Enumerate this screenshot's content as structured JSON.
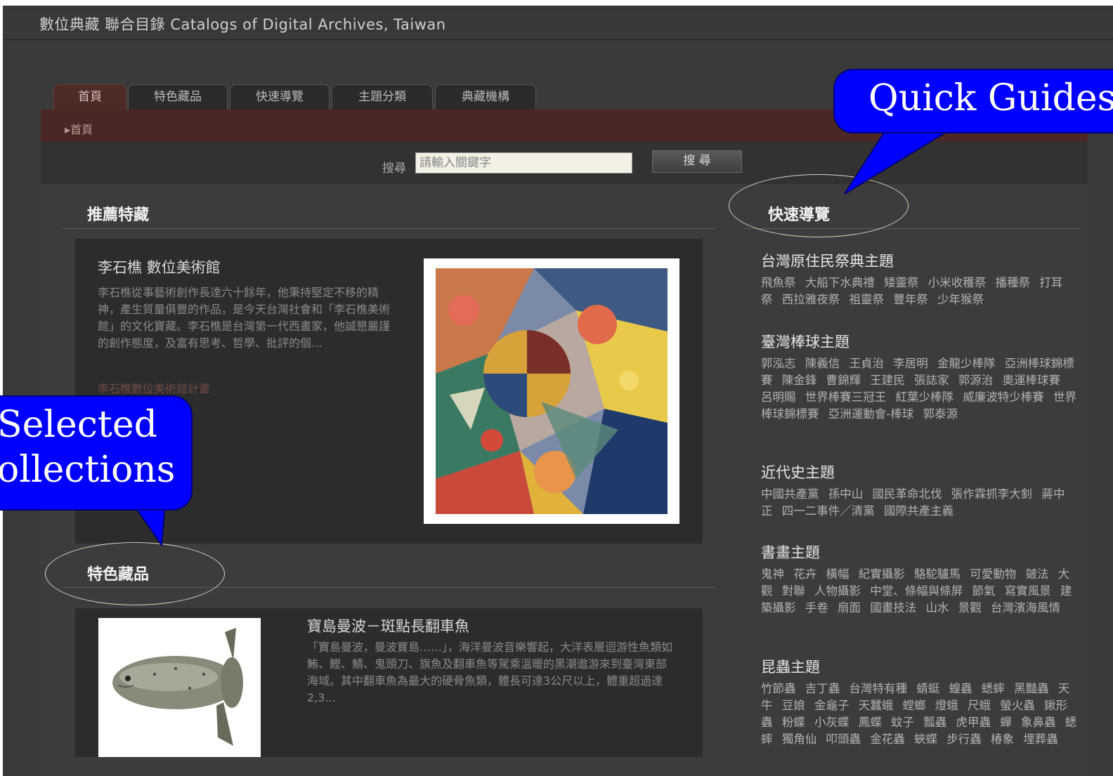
{
  "window": {
    "title": "數位典藏 聯合目錄 Catalogs of Digital Archives, Taiwan"
  },
  "tabs": [
    {
      "label": "首頁",
      "active": true
    },
    {
      "label": "特色藏品"
    },
    {
      "label": "快速導覽"
    },
    {
      "label": "主題分類"
    },
    {
      "label": "典藏機構"
    }
  ],
  "breadcrumb": "▸首頁",
  "search": {
    "label": "搜尋",
    "placeholder": "請輸入關鍵字",
    "button_label": "搜 尋"
  },
  "recommended": {
    "heading": "推薦特藏",
    "title": "李石樵 數位美術館",
    "description": "李石樵從事藝術創作長達六十餘年，他秉持堅定不移的精神，產生質量俱豐的作品，是今天台灣社會和「李石樵美術館」的文化寶藏。李石樵是台灣第一代西畫家，他誠懇嚴謹的創作態度，及富有思考、哲學、批評的個...",
    "link": "李石樵數位美術館計畫"
  },
  "featured": {
    "heading": "特色藏品",
    "title": "寶島曼波－斑點長翻車魚",
    "description": "「寶島曼波，曼波寶島……」，海洋曼波音樂響起，大洋表層迴游性魚類如鮪、鰹、鯖、鬼頭刀、旗魚及翻車魚等駕乘溫暖的黑潮遨游來到臺灣東部海域。其中翻車魚為最大的硬骨魚類，體長可達3公尺以上，體重超過達2,3..."
  },
  "quick_guide": {
    "heading": "快速導覽",
    "categories": [
      {
        "title": "台灣原住民祭典主題",
        "items": [
          "飛魚祭",
          "大船下水典禮",
          "矮靈祭",
          "小米收穫祭",
          "播種祭",
          "打耳祭",
          "西拉雅夜祭",
          "祖靈祭",
          "豐年祭",
          "少年猴祭"
        ]
      },
      {
        "title": "臺灣棒球主題",
        "items": [
          "郭泓志",
          "陳義信",
          "王貞治",
          "李居明",
          "金龍少棒隊",
          "亞洲棒球錦標賽",
          "陳金鋒",
          "曹錦輝",
          "王建民",
          "張誌家",
          "郭源治",
          "奧運棒球賽",
          "呂明賜",
          "世界棒賽三冠王",
          "紅葉少棒隊",
          "威廉波特少棒賽",
          "世界棒球錦標賽",
          "亞洲運動會-棒球",
          "郭泰源"
        ]
      },
      {
        "title": "近代史主題",
        "items": [
          "中國共產黨",
          "孫中山",
          "國民革命北伐",
          "張作霖抓李大釗",
          "蔣中正",
          "四一二事件／清黨",
          "國際共產主義"
        ]
      },
      {
        "title": "書畫主題",
        "items": [
          "鬼神",
          "花卉",
          "橫幅",
          "紀實攝影",
          "駱駝驢馬",
          "可愛動物",
          "皴法",
          "大觀",
          "對聯",
          "人物攝影",
          "中堂、條幅與條屏",
          "節氣",
          "寫實風景",
          "建築攝影",
          "手卷",
          "扇面",
          "國畫技法",
          "山水",
          "景觀",
          "台灣濱海風情"
        ]
      },
      {
        "title": "昆蟲主題",
        "items": [
          "竹節蟲",
          "吉丁蟲",
          "台灣特有種",
          "蜻蜓",
          "蝗蟲",
          "蟋蟀",
          "黑豔蟲",
          "天牛",
          "豆娘",
          "金龜子",
          "天蠶蛾",
          "螳螂",
          "燈蛾",
          "尺蛾",
          "螢火蟲",
          "鍬形蟲",
          "粉蝶",
          "小灰蝶",
          "鳳蝶",
          "蚊子",
          "瓢蟲",
          "虎甲蟲",
          "蟬",
          "象鼻蟲",
          "蟋蟀",
          "獨角仙",
          "叩頭蟲",
          "金花蟲",
          "蛺蝶",
          "步行蟲",
          "椿象",
          "埋葬蟲"
        ]
      }
    ]
  },
  "callouts": {
    "quick_guides": "Quick Guides",
    "selected_collections_line1": "Selected",
    "selected_collections_line2": "ollections"
  },
  "colors": {
    "callout": "#0000ff",
    "active_tab": "#4c2a26",
    "page_bg": "#3c3c3c"
  }
}
